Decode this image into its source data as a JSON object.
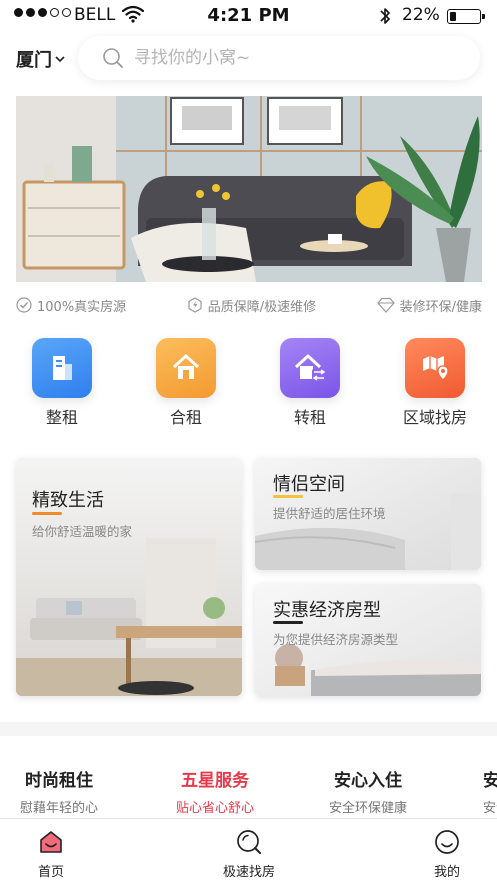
{
  "status_bar": {
    "carrier": "BELL",
    "time": "4:21 PM",
    "battery": "22%",
    "battery_level": 0.22
  },
  "header": {
    "city": "厦门",
    "search_placeholder": "寻找你的小窝~"
  },
  "banner": {
    "image_alt": "living-room-photo"
  },
  "features": [
    {
      "label": "100%真实房源",
      "icon": "check-circle-icon"
    },
    {
      "label": "品质保障/极速维修",
      "icon": "lightning-hexagon-icon"
    },
    {
      "label": "装修环保/健康",
      "icon": "diamond-icon"
    }
  ],
  "categories": [
    {
      "label": "整租",
      "icon": "building-icon",
      "color": "#3d8ff4"
    },
    {
      "label": "合租",
      "icon": "house-icon",
      "color": "#f7a743"
    },
    {
      "label": "转租",
      "icon": "house-transfer-icon",
      "color": "#8d67ef"
    },
    {
      "label": "区域找房",
      "icon": "map-pin-icon",
      "color": "#f5683d"
    }
  ],
  "cards": {
    "large": {
      "title": "精致生活",
      "subtitle": "给你舒适温暖的家",
      "accent": "#f08a2c"
    },
    "top": {
      "title": "情侣空间",
      "subtitle": "提供舒适的居住环境",
      "accent": "#f3c23a"
    },
    "bottom": {
      "title": "实惠经济房型",
      "subtitle": "为您提供经济房源类型",
      "accent": "#222222"
    }
  },
  "services": [
    {
      "title": "时尚租住",
      "subtitle": "慰藉年轻的心",
      "active": false
    },
    {
      "title": "五星服务",
      "subtitle": "贴心省心舒心",
      "active": true
    },
    {
      "title": "安心入住",
      "subtitle": "安全环保健康",
      "active": false
    },
    {
      "title": "安",
      "subtitle": "安全",
      "active": false
    }
  ],
  "tabbar": {
    "home": "首页",
    "quick": "极速找房",
    "mine": "我的"
  },
  "colors": {
    "accent_red": "#e8394b"
  }
}
